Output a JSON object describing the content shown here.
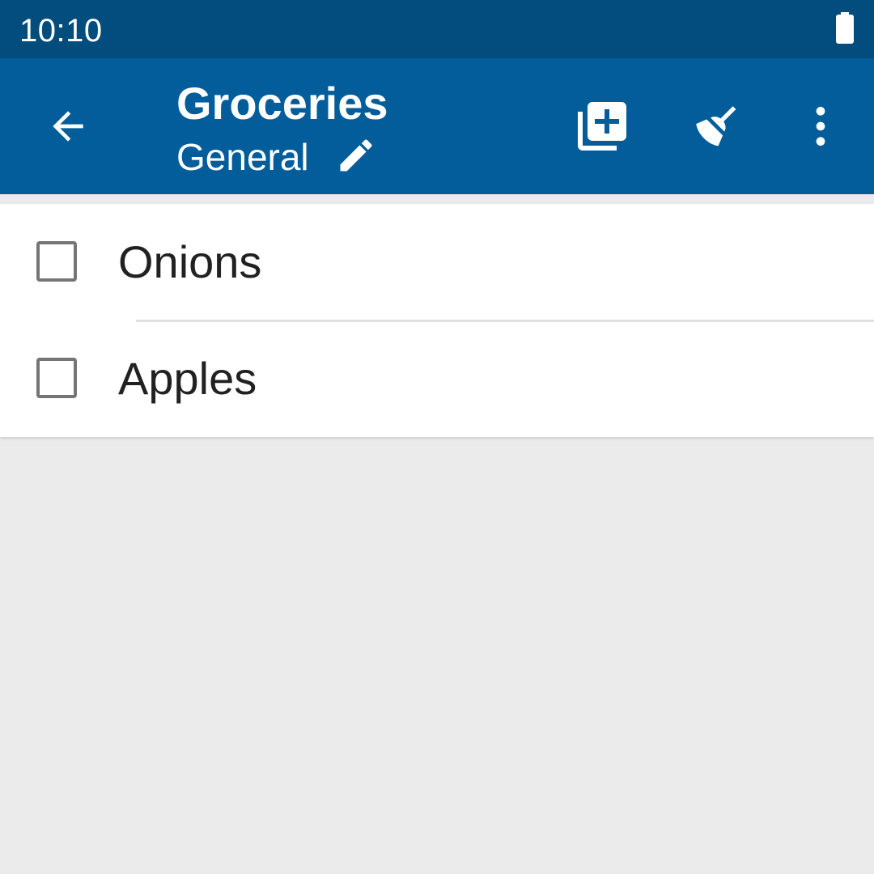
{
  "status_bar": {
    "time": "10:10"
  },
  "app_bar": {
    "title": "Groceries",
    "subtitle": "General",
    "icons": {
      "back": "arrow-left",
      "edit": "pencil",
      "add": "library-add",
      "clear": "broom",
      "more": "dots-vertical"
    }
  },
  "items": [
    {
      "label": "Onions",
      "checked": false
    },
    {
      "label": "Apples",
      "checked": false
    }
  ],
  "colors": {
    "status_bar": "#034c7e",
    "app_bar": "#025d9a",
    "background": "#ebebeb",
    "item_text": "#212121",
    "checkbox_border": "#757575"
  }
}
